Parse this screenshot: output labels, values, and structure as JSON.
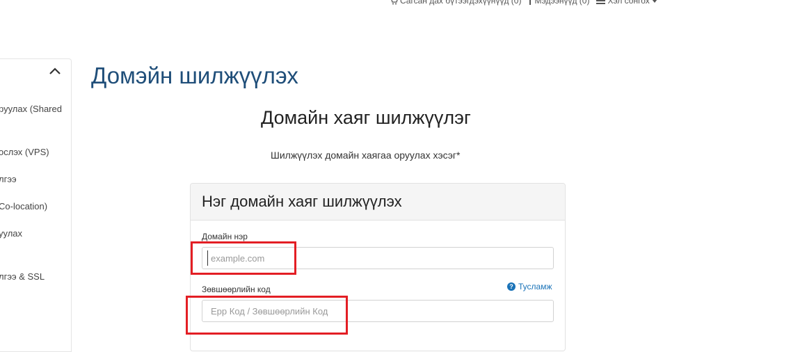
{
  "topbar": {
    "cart_label": "Сагсан дах бүтээгдэхүүнүүд (0)",
    "notifications_label": "Мэдээнүүд (0)",
    "language_label": "Хэл сонгох"
  },
  "sidebar": {
    "items": [
      {
        "label": "руулах (Shared"
      },
      {
        "label": "ослэх (VPS)"
      },
      {
        "label": "лгээ"
      },
      {
        "label": "Co-location)"
      },
      {
        "label": "уулах"
      },
      {
        "label": "лгээ & SSL"
      }
    ]
  },
  "page": {
    "title": "Домэйн шилжүүлэх",
    "section_title": "Домайн хаяг шилжүүлэг",
    "subtitle": "Шилжүүлэх домайн хаягаа оруулах хэсэг*"
  },
  "card": {
    "header": "Нэг домайн хаяг шилжүүлэх",
    "domain_label": "Домайн нэр",
    "domain_placeholder": "example.com",
    "domain_value": "",
    "auth_label": "Зөвшөөрлийн код",
    "auth_placeholder": "Epp Код / Зөвшөөрлийн Код",
    "auth_value": "",
    "help_label": "Туслaмж"
  },
  "colors": {
    "title": "#1f4e79",
    "link": "#1a73b8",
    "highlight": "#e31e24"
  }
}
